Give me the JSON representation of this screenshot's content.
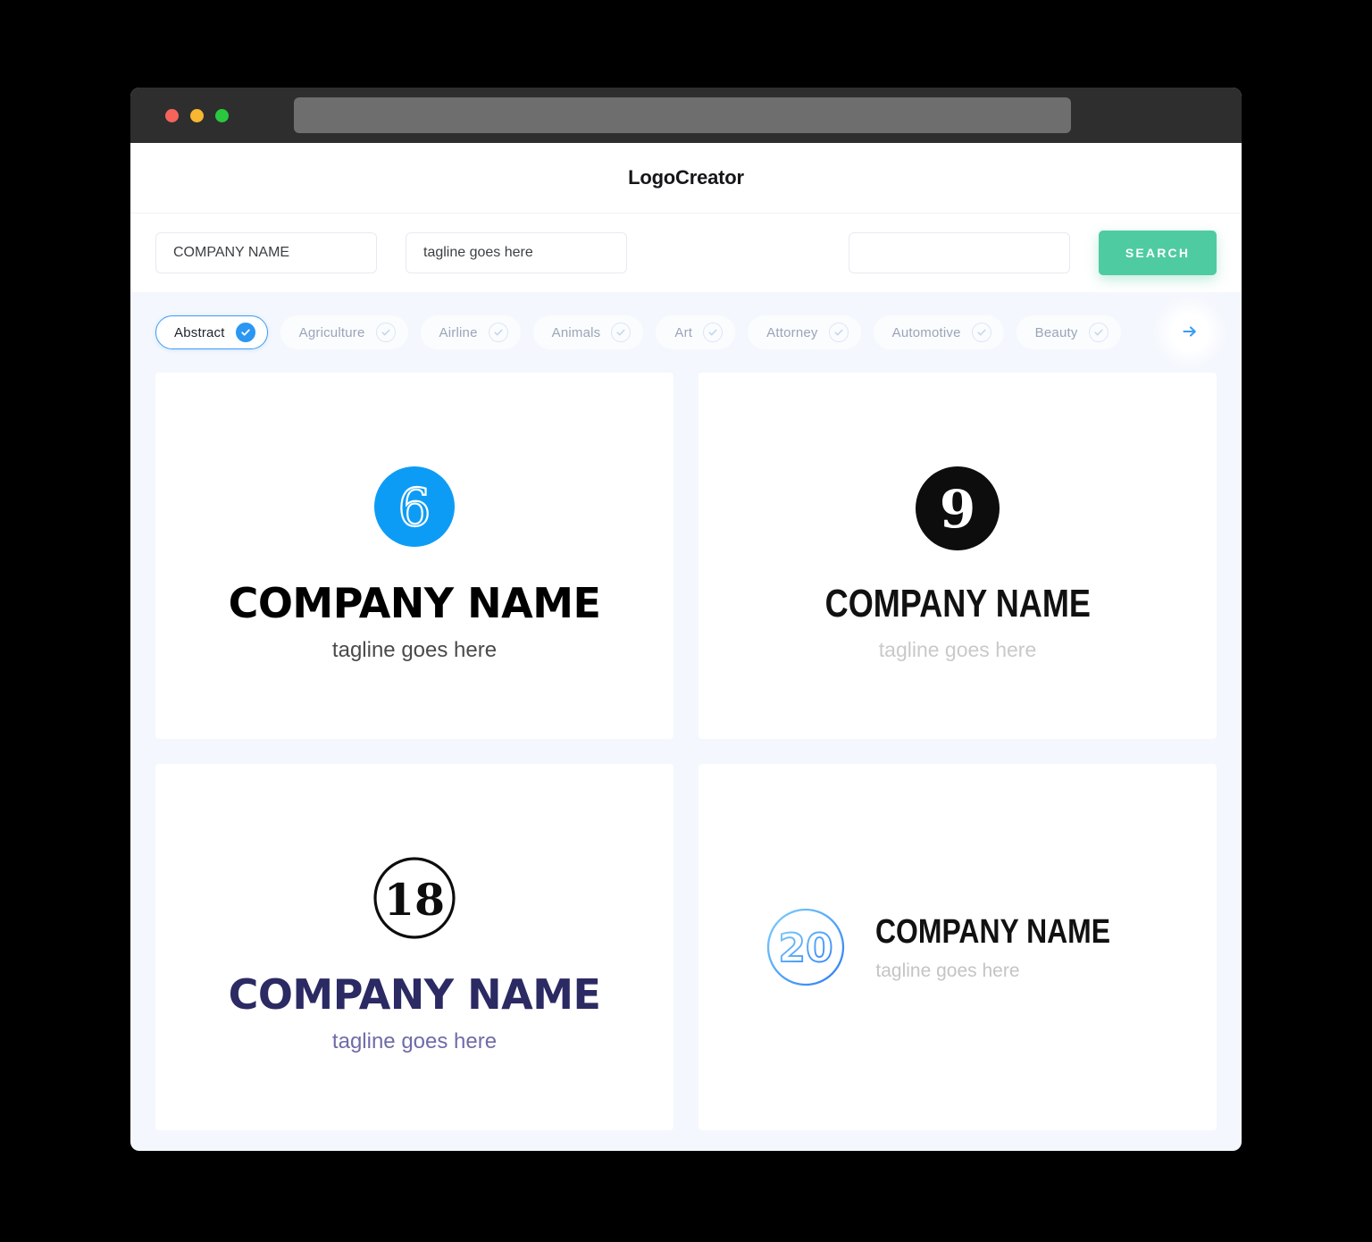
{
  "window": {
    "traffic_lights": [
      {
        "name": "close",
        "color": "#f4645b"
      },
      {
        "name": "minimize",
        "color": "#f7b731"
      },
      {
        "name": "maximize",
        "color": "#29c83f"
      }
    ],
    "url_value": ""
  },
  "header": {
    "title": "LogoCreator"
  },
  "search": {
    "company_value": "COMPANY NAME",
    "company_placeholder": "COMPANY NAME",
    "tagline_value": "tagline goes here",
    "tagline_placeholder": "tagline goes here",
    "keyword_value": "",
    "keyword_placeholder": "",
    "button_label": "SEARCH",
    "button_color": "#4ecba1"
  },
  "categories": {
    "next_icon": "arrow-right-icon",
    "selected": "Abstract",
    "items": [
      {
        "label": "Abstract",
        "selected": true
      },
      {
        "label": "Agriculture",
        "selected": false
      },
      {
        "label": "Airline",
        "selected": false
      },
      {
        "label": "Animals",
        "selected": false
      },
      {
        "label": "Art",
        "selected": false
      },
      {
        "label": "Attorney",
        "selected": false
      },
      {
        "label": "Automotive",
        "selected": false
      },
      {
        "label": "Beauty",
        "selected": false
      }
    ]
  },
  "results": [
    {
      "id": "logo-6",
      "mark_number": "6",
      "mark_style": "filled-circle-outline-numeral",
      "mark_color": "#0d9cf5",
      "numeral_color": "#ffffff",
      "brand_text": "COMPANY NAME",
      "brand_color": "#000000",
      "tagline_text": "tagline goes here",
      "tagline_color": "#4a4a4a",
      "layout": "stacked"
    },
    {
      "id": "logo-9",
      "mark_number": "9",
      "mark_style": "filled-circle-solid-numeral",
      "mark_color": "#0d0d0d",
      "numeral_color": "#ffffff",
      "brand_text": "COMPANY NAME",
      "brand_color": "#111111",
      "tagline_text": "tagline goes here",
      "tagline_color": "#c9c9c9",
      "layout": "stacked"
    },
    {
      "id": "logo-18",
      "mark_number": "18",
      "mark_style": "outlined-circle-solid-numeral",
      "mark_color": "#0d0d0d",
      "numeral_color": "#0d0d0d",
      "brand_text": "COMPANY NAME",
      "brand_color": "#2b2a63",
      "tagline_text": "tagline goes here",
      "tagline_color": "#6e6ca8",
      "layout": "stacked"
    },
    {
      "id": "logo-20",
      "mark_number": "20",
      "mark_style": "outlined-circle-outline-numeral",
      "mark_color": "#3aa0f5",
      "numeral_color": "#3aa0f5",
      "brand_text": "COMPANY NAME",
      "brand_color": "#111111",
      "tagline_text": "tagline goes here",
      "tagline_color": "#c4c4c4",
      "layout": "horizontal"
    }
  ]
}
